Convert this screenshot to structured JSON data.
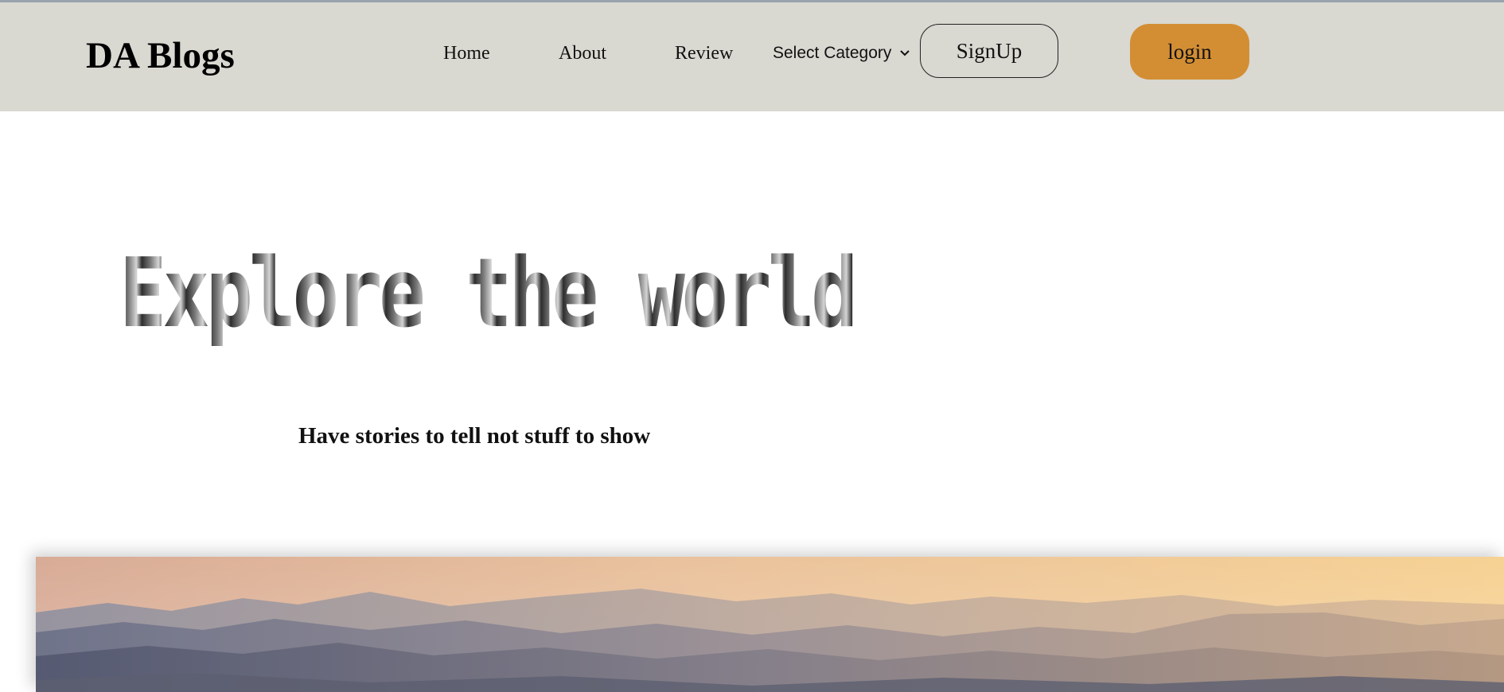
{
  "brand": {
    "title": "DA Blogs"
  },
  "nav": {
    "links": [
      "Home",
      "About",
      "Review"
    ],
    "category_label": "Select Category",
    "category_icon": "chevron-down-icon",
    "signup_label": "SignUp",
    "login_label": "login"
  },
  "hero": {
    "title": "Explore the world",
    "tagline": "Have stories to tell not stuff to show"
  },
  "colors": {
    "navbar_bg": "#d9d8d1",
    "login_accent": "#d38e34"
  }
}
